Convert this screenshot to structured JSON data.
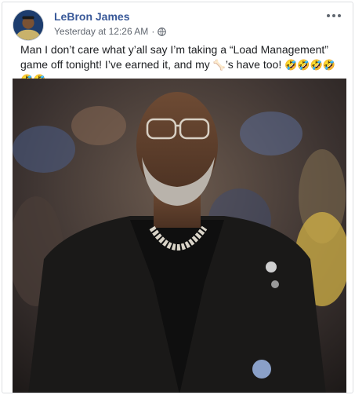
{
  "post": {
    "author": "LeBron James",
    "timestamp": "Yesterday at 12:26 AM",
    "separator": "·",
    "privacy_icon": "globe-icon",
    "text_before_emoji": "Man I don’t care what y’all say I’m taking a “Load Management” game off tonight! I’ve earned it, and my ",
    "bone_emoji": "🦴",
    "text_after_emoji": "’s have too! ",
    "laugh_emojis": "🤣🤣🤣🤣🤣🤣",
    "options_icon": "more-options-icon"
  },
  "colors": {
    "author_link": "#385898",
    "meta_text": "#616770",
    "border": "#dddfe2"
  }
}
